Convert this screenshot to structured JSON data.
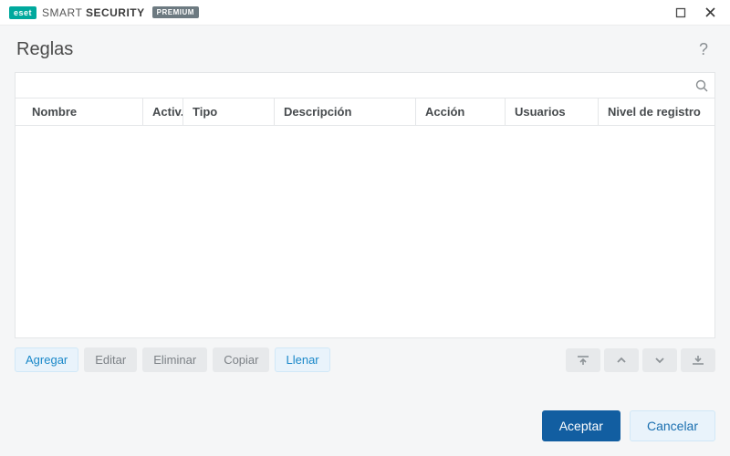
{
  "brand": {
    "logo_text": "eset",
    "product_prefix": "SMART",
    "product_suffix": "SECURITY",
    "tier": "PREMIUM"
  },
  "page": {
    "title": "Reglas",
    "help": "?"
  },
  "search": {
    "placeholder": "",
    "value": ""
  },
  "columns": {
    "name": "Nombre",
    "active": "Activ...",
    "type": "Tipo",
    "description": "Descripción",
    "action": "Acción",
    "users": "Usuarios",
    "log_level": "Nivel de registro"
  },
  "rows": [],
  "toolbar": {
    "add": "Agregar",
    "edit": "Editar",
    "remove": "Eliminar",
    "copy": "Copiar",
    "populate": "Llenar"
  },
  "footer": {
    "ok": "Aceptar",
    "cancel": "Cancelar"
  }
}
